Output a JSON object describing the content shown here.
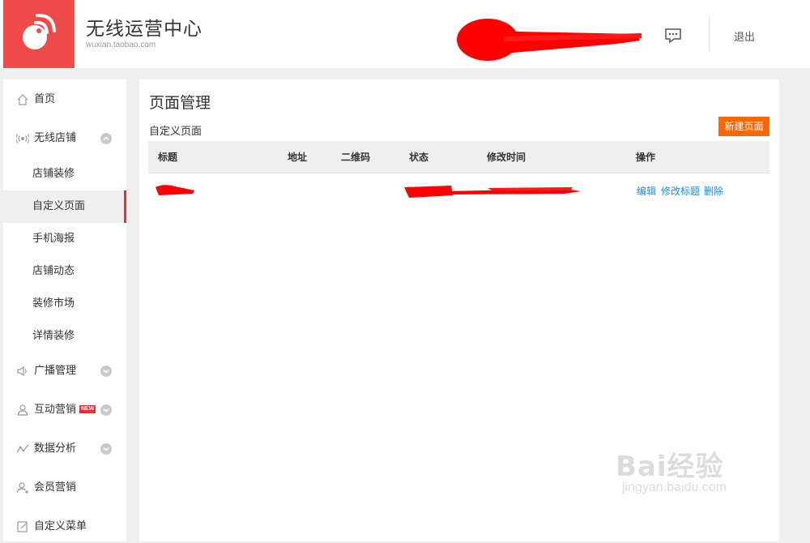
{
  "brand": {
    "title": "无线运营中心",
    "subtitle": "wuxian.taobao.com",
    "color": "#f0494a"
  },
  "header": {
    "logout_label": "退出",
    "message_icon": "message-icon"
  },
  "sidebar": {
    "items": [
      {
        "label": "首页",
        "icon": "home-icon"
      },
      {
        "label": "无线店铺",
        "icon": "wireless-icon",
        "expanded": true,
        "children": [
          "店铺装修",
          "自定义页面",
          "手机海报",
          "店铺动态",
          "装修市场",
          "详情装修"
        ],
        "active_child": "自定义页面"
      },
      {
        "label": "广播管理",
        "icon": "speaker-icon"
      },
      {
        "label": "互动营销",
        "icon": "user-icon",
        "badge": "NEW"
      },
      {
        "label": "数据分析",
        "icon": "chart-icon"
      },
      {
        "label": "会员营销",
        "icon": "member-icon"
      },
      {
        "label": "自定义菜单",
        "icon": "edit-icon"
      }
    ]
  },
  "main": {
    "page_title": "页面管理",
    "section_title": "自定义页面",
    "new_button": "新建页面",
    "columns": [
      "标题",
      "地址",
      "二维码",
      "状态",
      "修改时间",
      "操作"
    ],
    "row_actions": [
      "编辑",
      "修改标题",
      "删除"
    ],
    "accent_color": "#ff6600",
    "link_color": "#1a8ce8"
  },
  "watermark": {
    "main": "Bai经验",
    "sub": "jingyan.baidu.com"
  }
}
